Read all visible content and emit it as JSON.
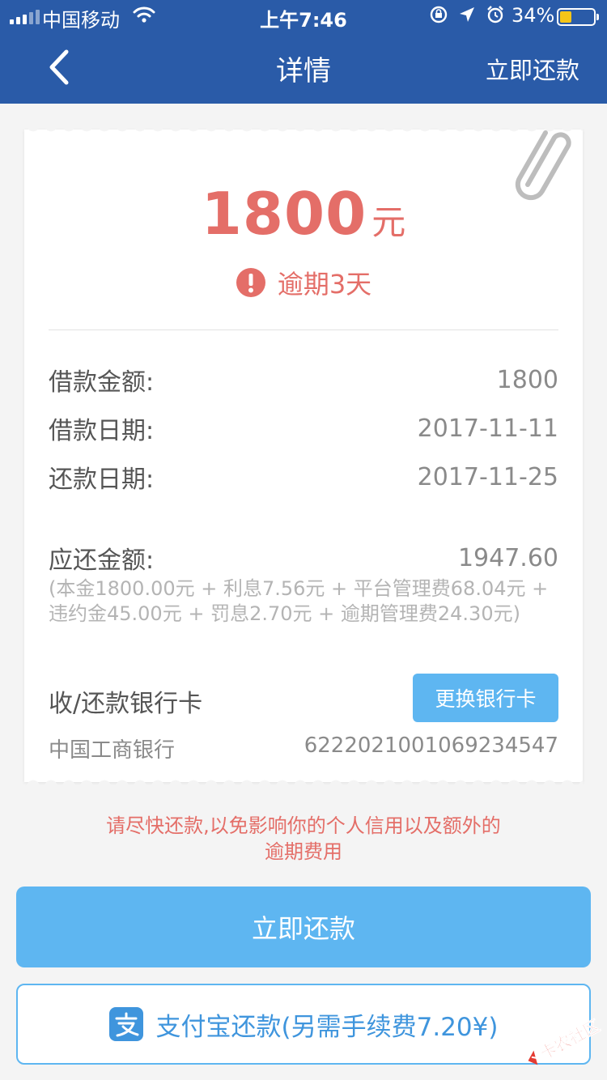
{
  "status_bar": {
    "carrier": "中国移动",
    "time": "上午7:46",
    "battery": "34%",
    "battery_level": 0.34
  },
  "nav": {
    "back_icon": "chevron-left-icon",
    "title": "详情",
    "action": "立即还款"
  },
  "summary": {
    "amount": "1800",
    "unit": "元",
    "overdue_text": "逾期3天",
    "overdue_icon": "exclamation-icon",
    "accent": "#e46e68"
  },
  "details": [
    {
      "label": "借款金额:",
      "value": "1800"
    },
    {
      "label": "借款日期:",
      "value": "2017-11-11"
    },
    {
      "label": "还款日期:",
      "value": "2017-11-25"
    }
  ],
  "due": {
    "label": "应还金额:",
    "value": "1947.60",
    "breakdown": "(本金1800.00元 + 利息7.56元 + 平台管理费68.04元 + 违约金45.00元 + 罚息2.70元 + 逾期管理费24.30元)"
  },
  "bank": {
    "title": "收/还款银行卡",
    "change_button": "更换银行卡",
    "name": "中国工商银行",
    "card_number": "6222021001069234547"
  },
  "warning": {
    "line1": "请尽快还款,以免影响你的个人信用以及额外的",
    "line2": "逾期费用"
  },
  "buttons": {
    "repay_now": "立即还款",
    "alipay": "支付宝还款(另需手续费7.20¥)",
    "primary_color": "#5eb6f1"
  },
  "watermark": "卡农社区"
}
